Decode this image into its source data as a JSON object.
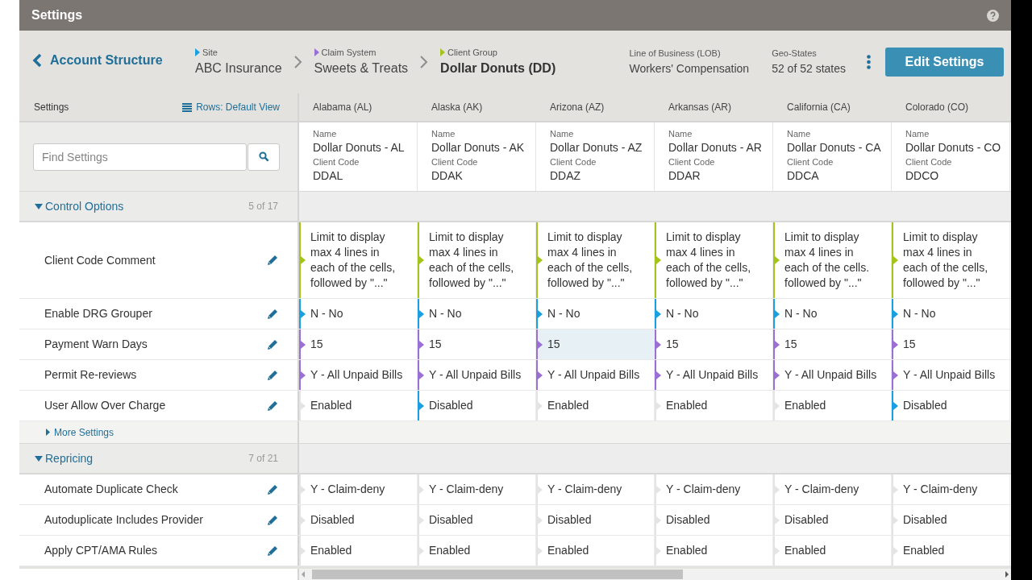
{
  "title": "Settings",
  "header": {
    "back_link": "Account Structure",
    "breadcrumbs": [
      {
        "label": "Site",
        "value": "ABC Insurance",
        "color": "#1a9fe0",
        "current": false
      },
      {
        "label": "Claim System",
        "value": "Sweets & Treats",
        "color": "#9a70d4",
        "current": false
      },
      {
        "label": "Client Group",
        "value": "Dollar Donuts (DD)",
        "color": "#a4c41c",
        "current": true
      }
    ],
    "info": [
      {
        "label": "Line of Business (LOB)",
        "value": "Workers' Compensation"
      },
      {
        "label": "Geo-States",
        "value": "52 of 52 states"
      }
    ],
    "edit_button": "Edit Settings"
  },
  "settings_label": "Settings",
  "rows_view": "Rows: Default View",
  "search": {
    "placeholder": "Find Settings"
  },
  "columns": [
    {
      "state": "Alabama (AL)",
      "name_label": "Name",
      "name": "Dollar Donuts - AL",
      "code_label": "Client Code",
      "code": "DDAL"
    },
    {
      "state": "Alaska (AK)",
      "name_label": "Name",
      "name": "Dollar Donuts - AK",
      "code_label": "Client Code",
      "code": "DDAK"
    },
    {
      "state": "Arizona (AZ)",
      "name_label": "Name",
      "name": "Dollar Donuts - AZ",
      "code_label": "Client Code",
      "code": "DDAZ"
    },
    {
      "state": "Arkansas (AR)",
      "name_label": "Name",
      "name": "Dollar Donuts - AR",
      "code_label": "Client Code",
      "code": "DDAR"
    },
    {
      "state": "California (CA)",
      "name_label": "Name",
      "name": "Dollar Donuts - CA",
      "code_label": "Client Code",
      "code": "DDCA"
    },
    {
      "state": "Colorado (CO)",
      "name_label": "Name",
      "name": "Dollar Donuts - CO",
      "code_label": "Client Code",
      "code": "DDCO"
    }
  ],
  "groups": [
    {
      "title": "Control Options",
      "count": "5 of 17",
      "expanded": true,
      "more": "More Settings",
      "rows": [
        {
          "label": "Client Code Comment",
          "kind": "tall",
          "cells": [
            {
              "value": "Limit to display max 4 lines in each of the cells, followed by \"...\"",
              "color": "#a4c41c",
              "selected": false
            },
            {
              "value": "Limit to display max 4 lines in each of the cells, followed by \"...\"",
              "color": "#a4c41c",
              "selected": false
            },
            {
              "value": "Limit to display max 4 lines in each of the cells, followed by \"...\"",
              "color": "#a4c41c",
              "selected": false
            },
            {
              "value": "Limit to display max 4 lines in each of the cells, followed by \"...\"",
              "color": "#a4c41c",
              "selected": false
            },
            {
              "value": "Limit to display max 4 lines in each of the cells. followed by \"...\"",
              "color": "#a4c41c",
              "selected": false
            },
            {
              "value": "Limit to display max 4 lines in each of the cells, followed by \"...\"",
              "color": "#a4c41c",
              "selected": false
            }
          ]
        },
        {
          "label": "Enable DRG Grouper",
          "kind": "normal",
          "cells": [
            {
              "value": "N - No",
              "color": "#1a9fe0",
              "selected": false
            },
            {
              "value": "N - No",
              "color": "#1a9fe0",
              "selected": false
            },
            {
              "value": "N - No",
              "color": "#1a9fe0",
              "selected": false
            },
            {
              "value": "N - No",
              "color": "#1a9fe0",
              "selected": false
            },
            {
              "value": "N - No",
              "color": "#1a9fe0",
              "selected": false
            },
            {
              "value": "N - No",
              "color": "#1a9fe0",
              "selected": false
            }
          ]
        },
        {
          "label": "Payment Warn Days",
          "kind": "normal",
          "cells": [
            {
              "value": "15",
              "color": "#9a70d4",
              "selected": false
            },
            {
              "value": "15",
              "color": "#9a70d4",
              "selected": false
            },
            {
              "value": "15",
              "color": "#9a70d4",
              "selected": true
            },
            {
              "value": "15",
              "color": "#9a70d4",
              "selected": false
            },
            {
              "value": "15",
              "color": "#9a70d4",
              "selected": false
            },
            {
              "value": "15",
              "color": "#9a70d4",
              "selected": false
            }
          ]
        },
        {
          "label": "Permit Re-reviews",
          "kind": "normal",
          "cells": [
            {
              "value": "Y - All Unpaid Bills",
              "color": "#9a70d4",
              "selected": false
            },
            {
              "value": "Y - All Unpaid Bills",
              "color": "#9a70d4",
              "selected": false
            },
            {
              "value": "Y - All Unpaid Bills",
              "color": "#9a70d4",
              "selected": false
            },
            {
              "value": "Y - All Unpaid Bills",
              "color": "#9a70d4",
              "selected": false
            },
            {
              "value": "Y - All Unpaid Bills",
              "color": "#9a70d4",
              "selected": false
            },
            {
              "value": "Y - All Unpaid Bills",
              "color": "#9a70d4",
              "selected": false
            }
          ]
        },
        {
          "label": "User Allow Over Charge",
          "kind": "normal",
          "cells": [
            {
              "value": "Enabled",
              "color": "#e4e4e4",
              "selected": false
            },
            {
              "value": "Disabled",
              "color": "#1a9fe0",
              "selected": false
            },
            {
              "value": "Enabled",
              "color": "#e4e4e4",
              "selected": false
            },
            {
              "value": "Enabled",
              "color": "#e4e4e4",
              "selected": false
            },
            {
              "value": "Enabled",
              "color": "#e4e4e4",
              "selected": false
            },
            {
              "value": "Disabled",
              "color": "#1a9fe0",
              "selected": false
            }
          ]
        }
      ]
    },
    {
      "title": "Repricing",
      "count": "7 of 21",
      "expanded": true,
      "rows": [
        {
          "label": "Automate Duplicate Check",
          "kind": "normal",
          "cells": [
            {
              "value": "Y - Claim-deny",
              "color": "#e4e4e4",
              "selected": false
            },
            {
              "value": "Y - Claim-deny",
              "color": "#e4e4e4",
              "selected": false
            },
            {
              "value": "Y - Claim-deny",
              "color": "#e4e4e4",
              "selected": false
            },
            {
              "value": "Y - Claim-deny",
              "color": "#e4e4e4",
              "selected": false
            },
            {
              "value": "Y - Claim-deny",
              "color": "#e4e4e4",
              "selected": false
            },
            {
              "value": "Y - Claim-deny",
              "color": "#e4e4e4",
              "selected": false
            }
          ]
        },
        {
          "label": "Autoduplicate Includes Provider",
          "kind": "normal",
          "cells": [
            {
              "value": "Disabled",
              "color": "#e4e4e4",
              "selected": false
            },
            {
              "value": "Disabled",
              "color": "#e4e4e4",
              "selected": false
            },
            {
              "value": "Disabled",
              "color": "#e4e4e4",
              "selected": false
            },
            {
              "value": "Disabled",
              "color": "#e4e4e4",
              "selected": false
            },
            {
              "value": "Disabled",
              "color": "#e4e4e4",
              "selected": false
            },
            {
              "value": "Disabled",
              "color": "#e4e4e4",
              "selected": false
            }
          ]
        },
        {
          "label": "Apply CPT/AMA Rules",
          "kind": "normal",
          "cells": [
            {
              "value": "Enabled",
              "color": "#e4e4e4",
              "selected": false
            },
            {
              "value": "Enabled",
              "color": "#e4e4e4",
              "selected": false
            },
            {
              "value": "Enabled",
              "color": "#e4e4e4",
              "selected": false
            },
            {
              "value": "Enabled",
              "color": "#e4e4e4",
              "selected": false
            },
            {
              "value": "Enabled",
              "color": "#e4e4e4",
              "selected": false
            },
            {
              "value": "Enabled",
              "color": "#e4e4e4",
              "selected": false
            }
          ]
        }
      ]
    }
  ]
}
